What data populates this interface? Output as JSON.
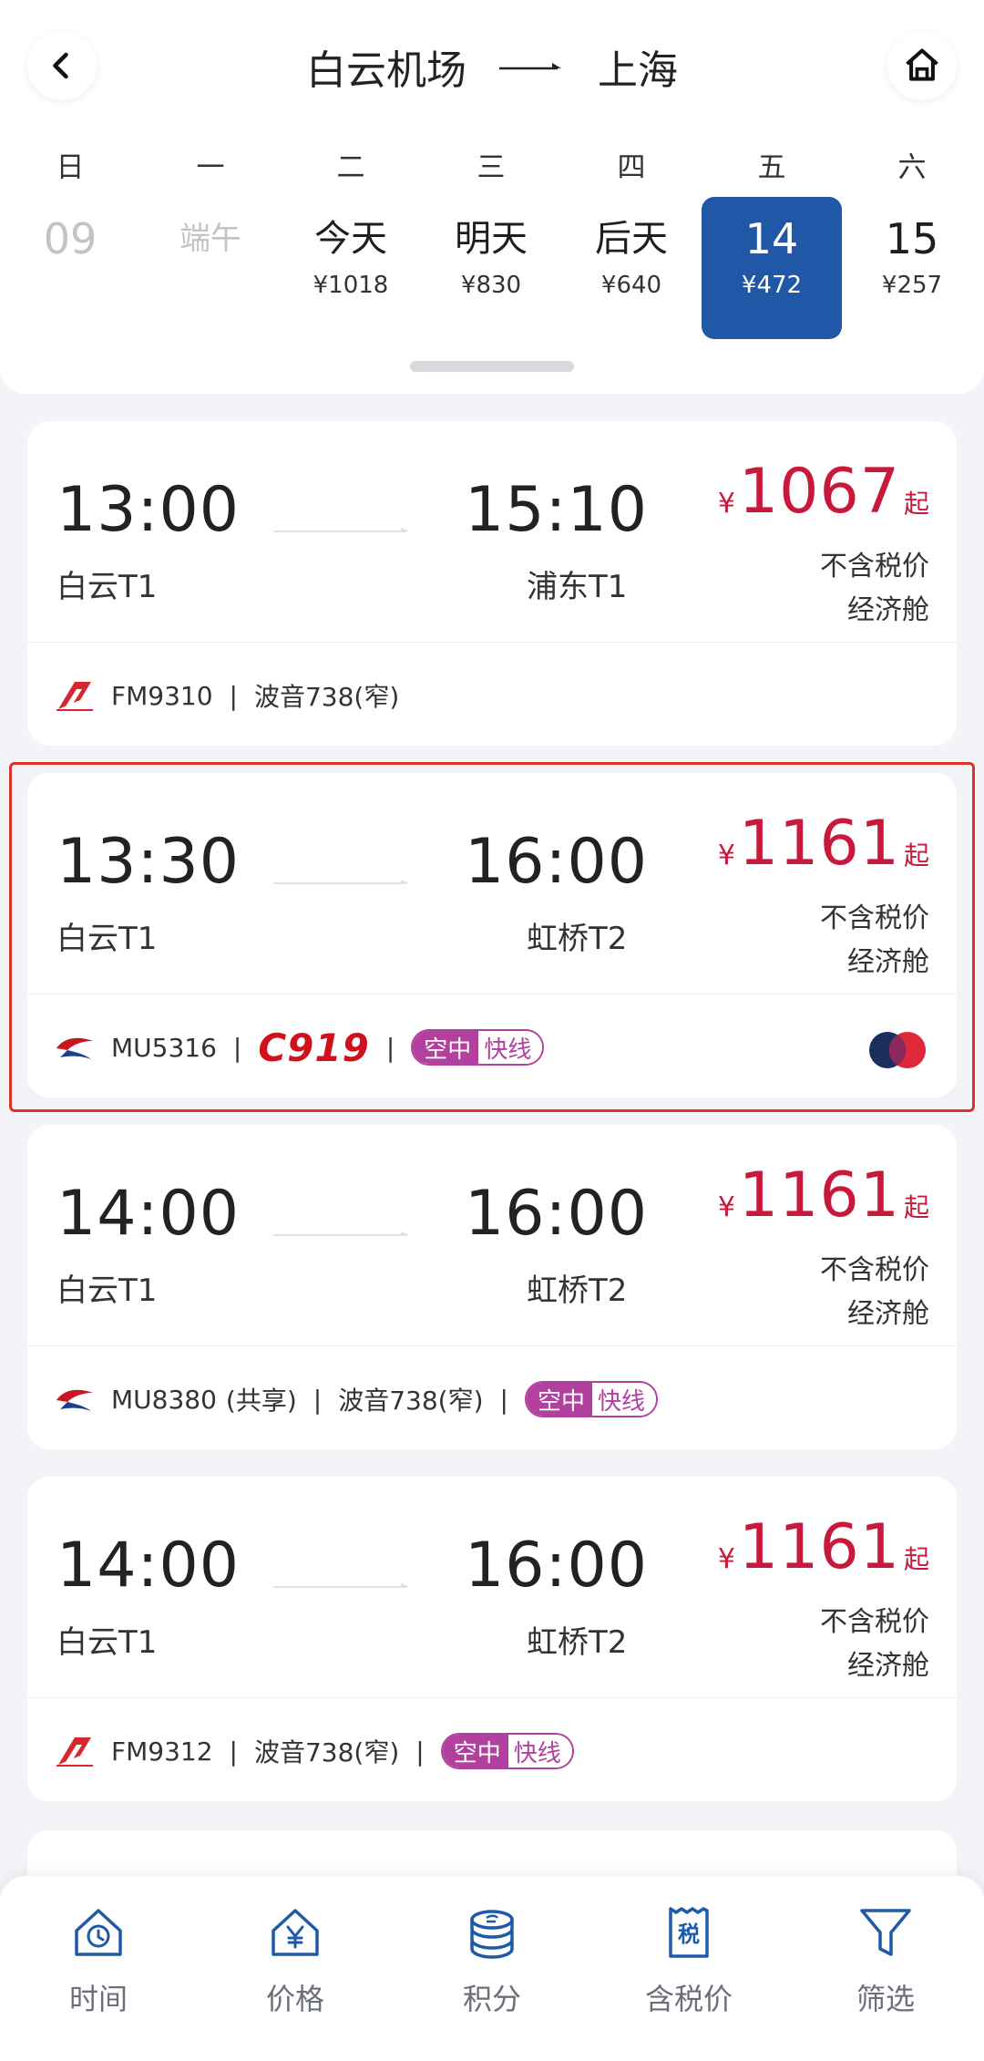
{
  "header": {
    "origin": "白云机场",
    "destination": "上海",
    "weekdays": [
      "日",
      "一",
      "二",
      "三",
      "四",
      "五",
      "六"
    ],
    "dates": [
      {
        "label": "09",
        "price": ""
      },
      {
        "label": "端午",
        "price": ""
      },
      {
        "label": "今天",
        "price": "¥1018"
      },
      {
        "label": "明天",
        "price": "¥830"
      },
      {
        "label": "后天",
        "price": "¥640"
      },
      {
        "label": "14",
        "price": "¥472"
      },
      {
        "label": "15",
        "price": "¥257"
      }
    ]
  },
  "flights": [
    {
      "dep_time": "13:00",
      "arr_time": "15:10",
      "dep_airport": "白云T1",
      "arr_airport": "浦东T1",
      "yen": "¥",
      "price": "1067",
      "qi": "起",
      "tax_note": "不含税价",
      "cabin": "经济舱",
      "flight_no": "FM9310",
      "aircraft": "波音738(窄)"
    },
    {
      "dep_time": "13:30",
      "arr_time": "16:00",
      "dep_airport": "白云T1",
      "arr_airport": "虹桥T2",
      "yen": "¥",
      "price": "1161",
      "qi": "起",
      "tax_note": "不含税价",
      "cabin": "经济舱",
      "flight_no": "MU5316",
      "aircraft_logo": "C919",
      "badge_a": "空中",
      "badge_b": "快线"
    },
    {
      "dep_time": "14:00",
      "arr_time": "16:00",
      "dep_airport": "白云T1",
      "arr_airport": "虹桥T2",
      "yen": "¥",
      "price": "1161",
      "qi": "起",
      "tax_note": "不含税价",
      "cabin": "经济舱",
      "flight_no": "MU8380",
      "shared": "(共享)",
      "aircraft": "波音738(窄)",
      "badge_a": "空中",
      "badge_b": "快线"
    },
    {
      "dep_time": "14:00",
      "arr_time": "16:00",
      "dep_airport": "白云T1",
      "arr_airport": "虹桥T2",
      "yen": "¥",
      "price": "1161",
      "qi": "起",
      "tax_note": "不含税价",
      "cabin": "经济舱",
      "flight_no": "FM9312",
      "aircraft": "波音738(窄)",
      "badge_a": "空中",
      "badge_b": "快线"
    }
  ],
  "separator": "|",
  "tabs": [
    {
      "label": "时间",
      "icon": "clock-house-icon"
    },
    {
      "label": "价格",
      "icon": "yen-house-icon"
    },
    {
      "label": "积分",
      "icon": "coins-icon"
    },
    {
      "label": "含税价",
      "icon": "tax-receipt-icon",
      "icon_text": "税"
    },
    {
      "label": "筛选",
      "icon": "filter-icon"
    }
  ],
  "colors": {
    "accent": "#2057a6",
    "price": "#c8183c",
    "badge": "#b2409e",
    "highlight": "#e0302a"
  }
}
